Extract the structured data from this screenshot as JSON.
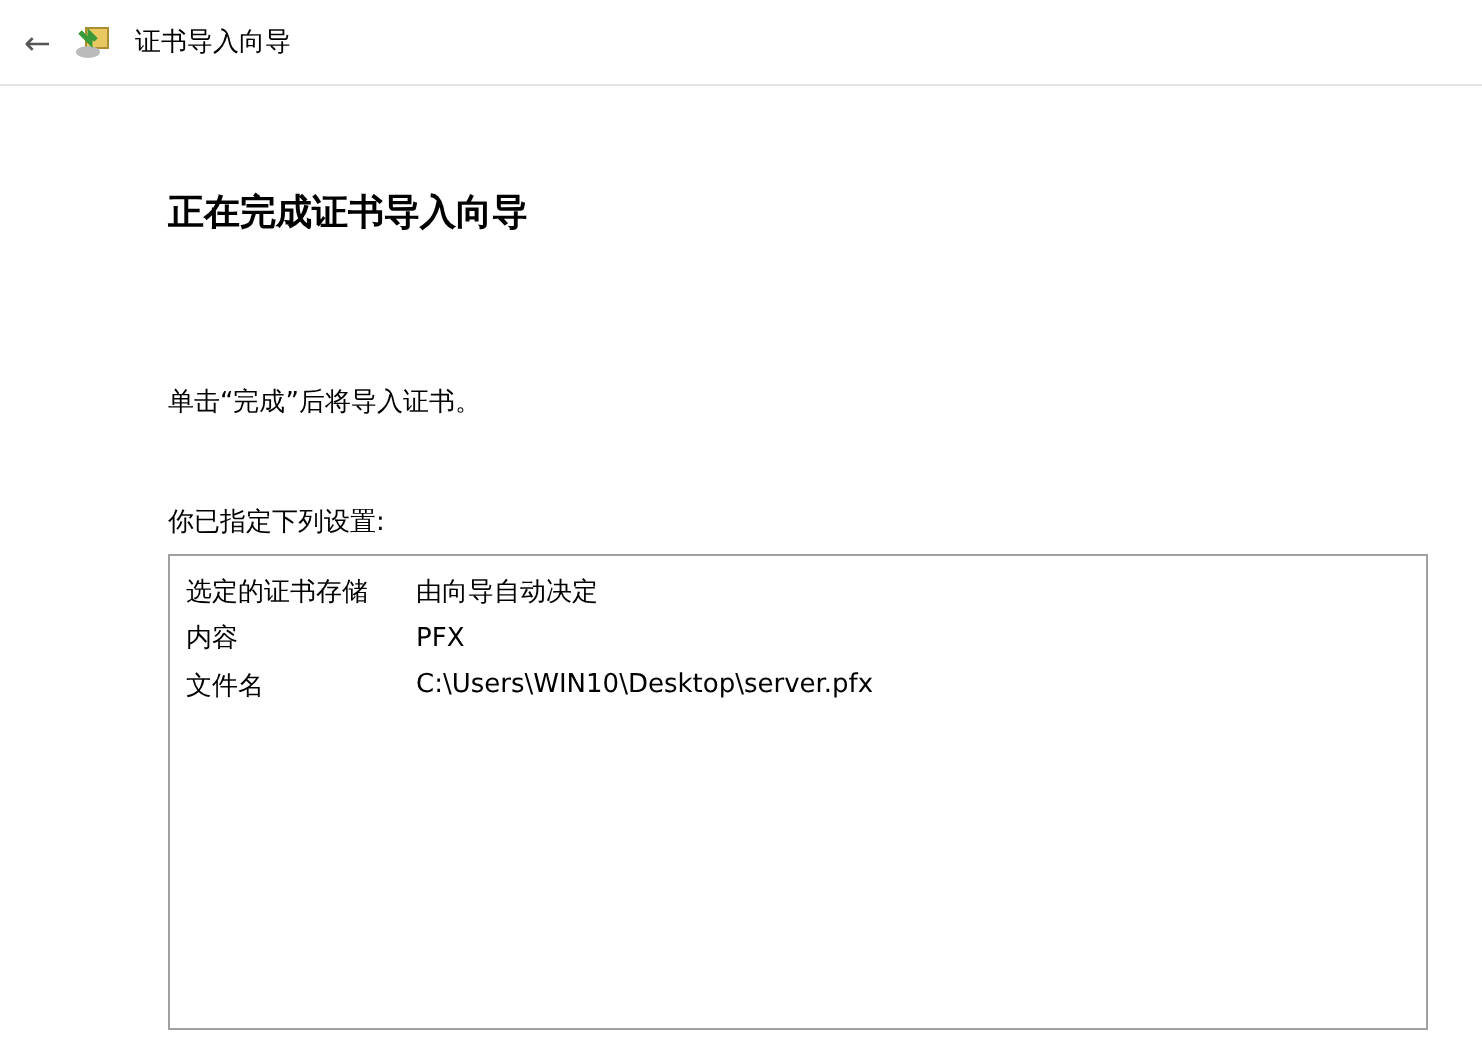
{
  "header": {
    "back": "←",
    "title": "证书导入向导"
  },
  "heading": "正在完成证书导入向导",
  "instruction": "单击“完成”后将导入证书。",
  "settings_label": "你已指定下列设置:",
  "settings": [
    {
      "name": "选定的证书存储",
      "value": "由向导自动决定"
    },
    {
      "name": "内容",
      "value": "PFX"
    },
    {
      "name": "文件名",
      "value": "C:\\Users\\WIN10\\Desktop\\server.pfx"
    }
  ]
}
